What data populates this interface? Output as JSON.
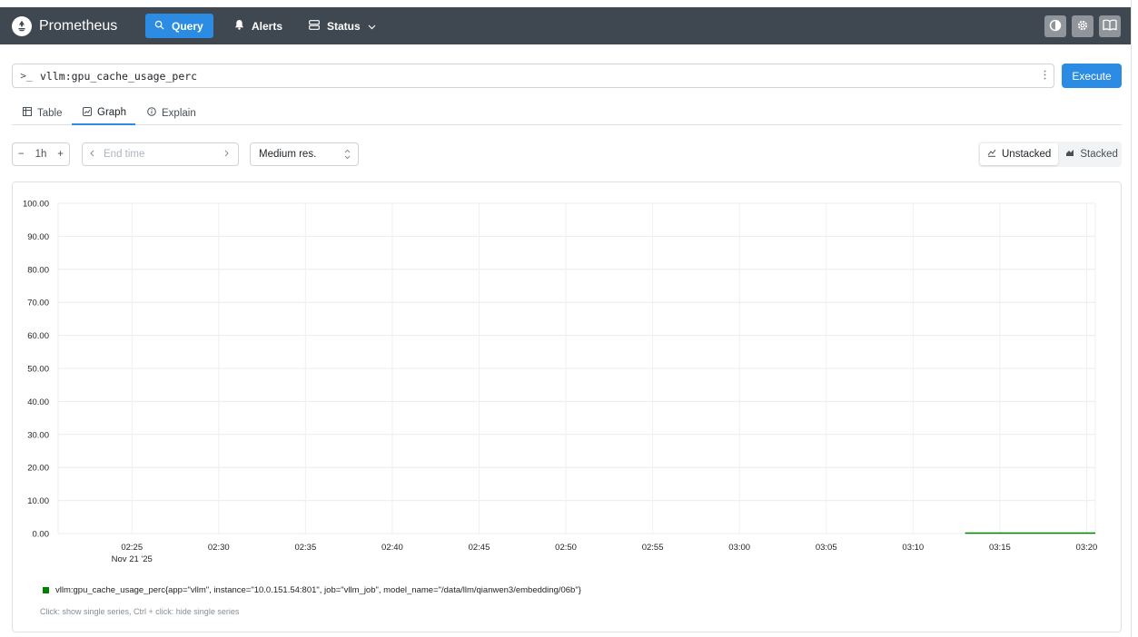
{
  "app": {
    "brand": "Prometheus",
    "icons": [
      "prometheus-logo-icon",
      "search-icon",
      "bell-icon",
      "server-icon",
      "chevron-down-icon",
      "theme-toggle-icon",
      "gear-icon",
      "book-icon"
    ]
  },
  "nav": {
    "query": "Query",
    "alerts": "Alerts",
    "status": "Status"
  },
  "query": {
    "prompt": ">_",
    "expression": "vllm:gpu_cache_usage_perc",
    "execute": "Execute"
  },
  "tabs": {
    "table": "Table",
    "graph": "Graph",
    "explain": "Explain",
    "active": "Graph"
  },
  "controls": {
    "minus": "−",
    "range": "1h",
    "plus": "+",
    "end_time_placeholder": "End time",
    "resolution": "Medium res.",
    "unstacked": "Unstacked",
    "stacked": "Stacked",
    "stack_mode": "Unstacked"
  },
  "chart_data": {
    "type": "line",
    "y_ticks": [
      "100.00",
      "90.00",
      "80.00",
      "70.00",
      "60.00",
      "50.00",
      "40.00",
      "30.00",
      "20.00",
      "10.00",
      "0.00"
    ],
    "ylim": [
      0,
      100
    ],
    "x_ticks": [
      "02:25",
      "02:30",
      "02:35",
      "02:40",
      "02:45",
      "02:50",
      "02:55",
      "03:00",
      "03:05",
      "03:10",
      "03:15",
      "03:20"
    ],
    "x_date_label": "Nov 21 '25",
    "xlim": [
      "02:20:45",
      "03:20:30"
    ],
    "grid": true,
    "series": [
      {
        "name": "vllm:gpu_cache_usage_perc{app=\"vllm\", instance=\"10.0.151.54:801\", job=\"vllm_job\", model_name=\"/data/llm/qianwen3/embedding/06b\"}",
        "color": "#008000",
        "x": [
          "03:13:00",
          "03:20:30"
        ],
        "values": [
          0,
          0
        ]
      }
    ],
    "legend_hint": "Click: show single series, Ctrl + click: hide single series"
  }
}
